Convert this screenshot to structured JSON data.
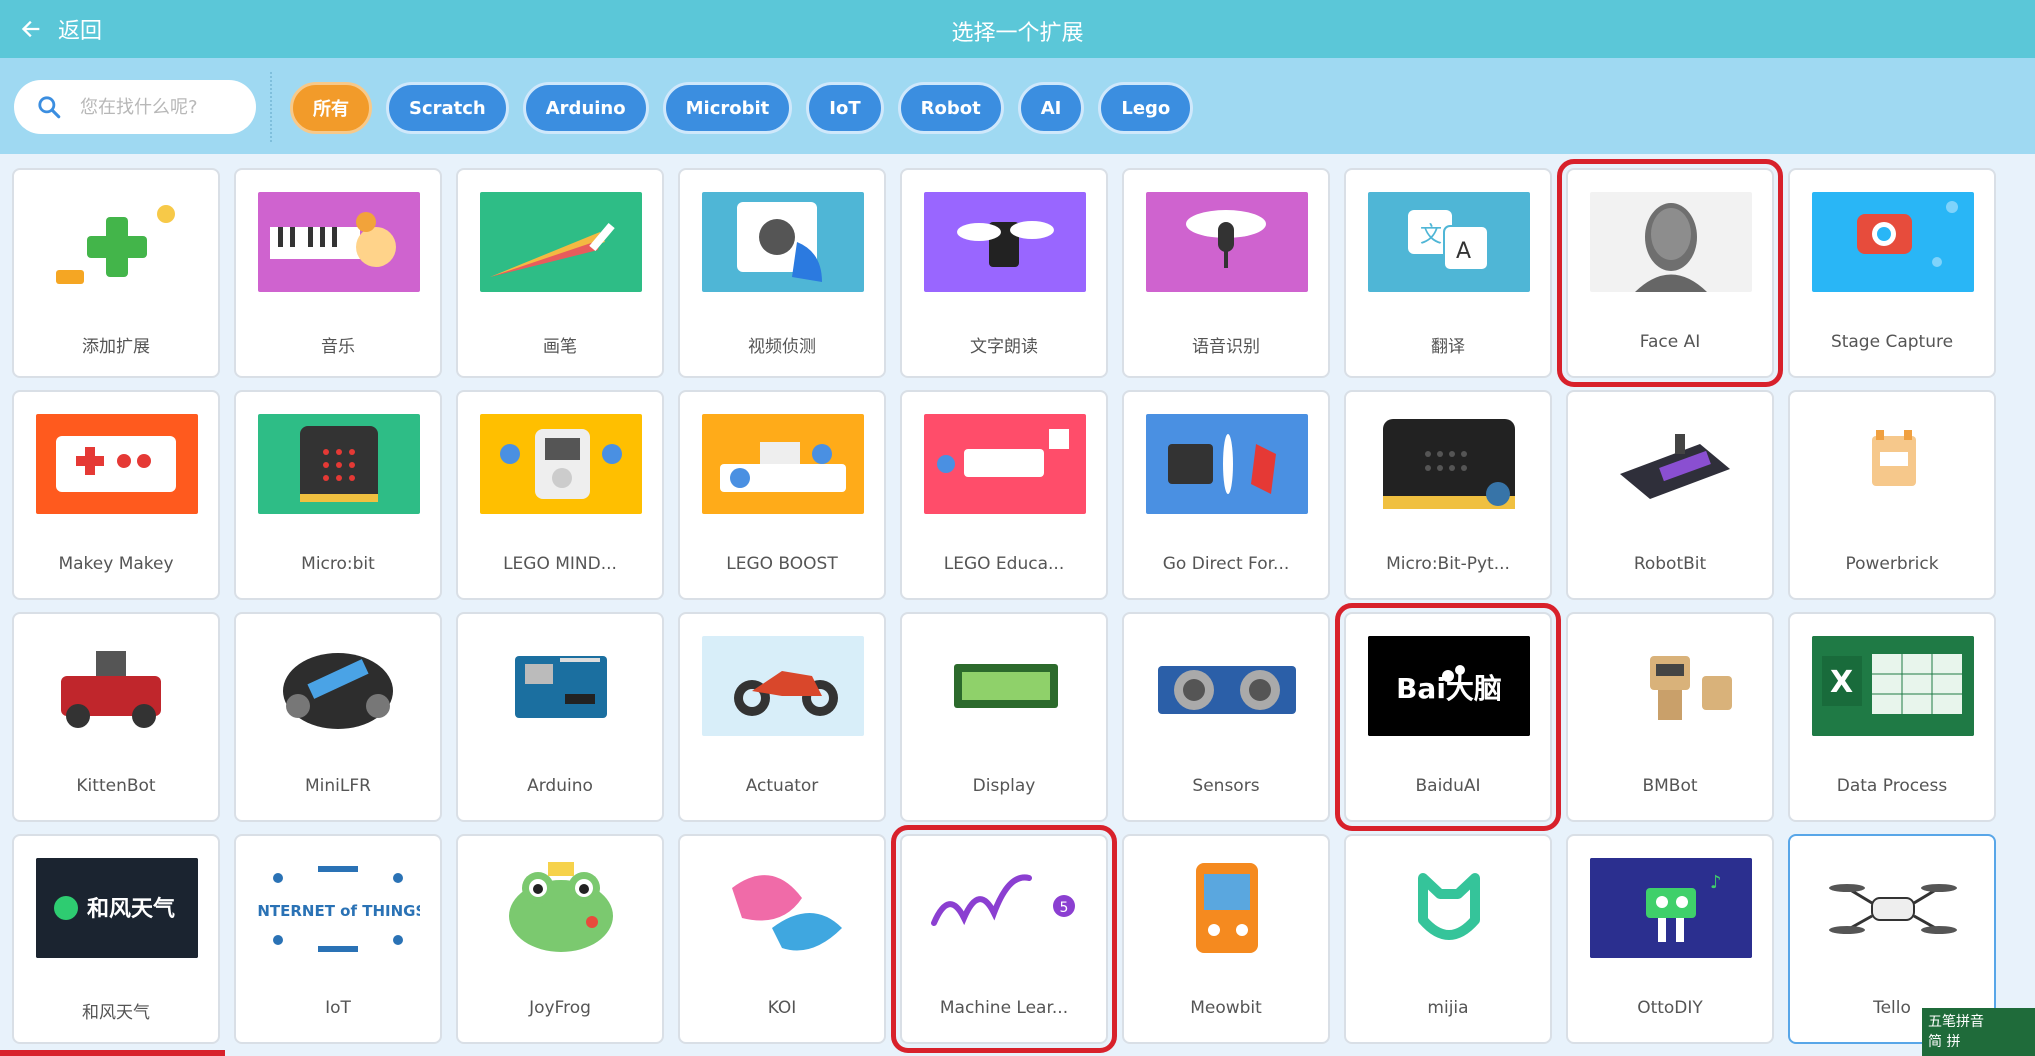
{
  "header": {
    "back_label": "返回",
    "title": "选择一个扩展"
  },
  "filters": {
    "search_placeholder": "您在找什么呢?",
    "chips": [
      "所有",
      "Scratch",
      "Arduino",
      "Microbit",
      "IoT",
      "Robot",
      "AI",
      "Lego"
    ],
    "active_chip": "所有"
  },
  "extensions": [
    {
      "label": "添加扩展",
      "icon": "add-extension-icon",
      "bg": "#ffffff"
    },
    {
      "label": "音乐",
      "icon": "music-icon",
      "bg": "#cf63cf"
    },
    {
      "label": "画笔",
      "icon": "pen-icon",
      "bg": "#2ebd86"
    },
    {
      "label": "视频侦测",
      "icon": "video-sensing-icon",
      "bg": "#4fb6d6"
    },
    {
      "label": "文字朗读",
      "icon": "text-to-speech-icon",
      "bg": "#9966ff"
    },
    {
      "label": "语音识别",
      "icon": "speech-recognition-icon",
      "bg": "#cf63cf"
    },
    {
      "label": "翻译",
      "icon": "translate-icon",
      "bg": "#4fb6d6"
    },
    {
      "label": "Face AI",
      "icon": "face-ai-icon",
      "bg": "#ffffff",
      "highlight": true
    },
    {
      "label": "Stage Capture",
      "icon": "camera-icon",
      "bg": "#29b6f6"
    },
    {
      "label": "Makey Makey",
      "icon": "makey-makey-icon",
      "bg": "#ff5a1e"
    },
    {
      "label": "Micro:bit",
      "icon": "microbit-icon",
      "bg": "#2ebd86"
    },
    {
      "label": "LEGO MIND...",
      "icon": "lego-mindstorms-icon",
      "bg": "#ffbf00"
    },
    {
      "label": "LEGO BOOST",
      "icon": "lego-boost-icon",
      "bg": "#ffab19"
    },
    {
      "label": "LEGO Educa...",
      "icon": "lego-wedo-icon",
      "bg": "#ff4d6a"
    },
    {
      "label": "Go Direct For...",
      "icon": "force-sensor-icon",
      "bg": "#4a90e2"
    },
    {
      "label": "Micro:Bit-Pyt...",
      "icon": "microbit-python-icon",
      "bg": "#ffffff"
    },
    {
      "label": "RobotBit",
      "icon": "robotbit-icon",
      "bg": "#ffffff"
    },
    {
      "label": "Powerbrick",
      "icon": "powerbrick-icon",
      "bg": "#ffffff"
    },
    {
      "label": "KittenBot",
      "icon": "kittenbot-icon",
      "bg": "#ffffff"
    },
    {
      "label": "MiniLFR",
      "icon": "minilfr-icon",
      "bg": "#ffffff"
    },
    {
      "label": "Arduino",
      "icon": "arduino-board-icon",
      "bg": "#ffffff"
    },
    {
      "label": "Actuator",
      "icon": "motorcycle-icon",
      "bg": "#d8eef9"
    },
    {
      "label": "Display",
      "icon": "lcd-display-icon",
      "bg": "#ffffff"
    },
    {
      "label": "Sensors",
      "icon": "ultrasonic-sensor-icon",
      "bg": "#ffffff"
    },
    {
      "label": "BaiduAI",
      "icon": "baidu-ai-icon",
      "bg": "#000000",
      "highlight": true,
      "logo_text": "Bai大脑"
    },
    {
      "label": "BMBot",
      "icon": "bmbot-icon",
      "bg": "#ffffff"
    },
    {
      "label": "Data Process",
      "icon": "excel-icon",
      "bg": "#1f7a45"
    },
    {
      "label": "和风天气",
      "icon": "weather-icon",
      "bg": "#1b2430",
      "logo_text": "和风天气"
    },
    {
      "label": "IoT",
      "icon": "internet-of-things-icon",
      "bg": "#ffffff",
      "logo_text": "INTERNET of THINGS"
    },
    {
      "label": "JoyFrog",
      "icon": "frog-icon",
      "bg": "#ffffff"
    },
    {
      "label": "KOI",
      "icon": "koi-fish-icon",
      "bg": "#ffffff"
    },
    {
      "label": "Machine Lear...",
      "icon": "ml5-icon",
      "bg": "#ffffff",
      "highlight": true,
      "logo_text": "ml5"
    },
    {
      "label": "Meowbit",
      "icon": "meowbit-icon",
      "bg": "#ffffff"
    },
    {
      "label": "mijia",
      "icon": "mijia-icon",
      "bg": "#ffffff"
    },
    {
      "label": "OttoDIY",
      "icon": "otto-robot-icon",
      "bg": "#2b2f8f"
    },
    {
      "label": "Tello",
      "icon": "drone-icon",
      "bg": "#ffffff",
      "selected": true
    }
  ],
  "ime": {
    "line1": "五笔拼音",
    "line2": "简 拼"
  }
}
